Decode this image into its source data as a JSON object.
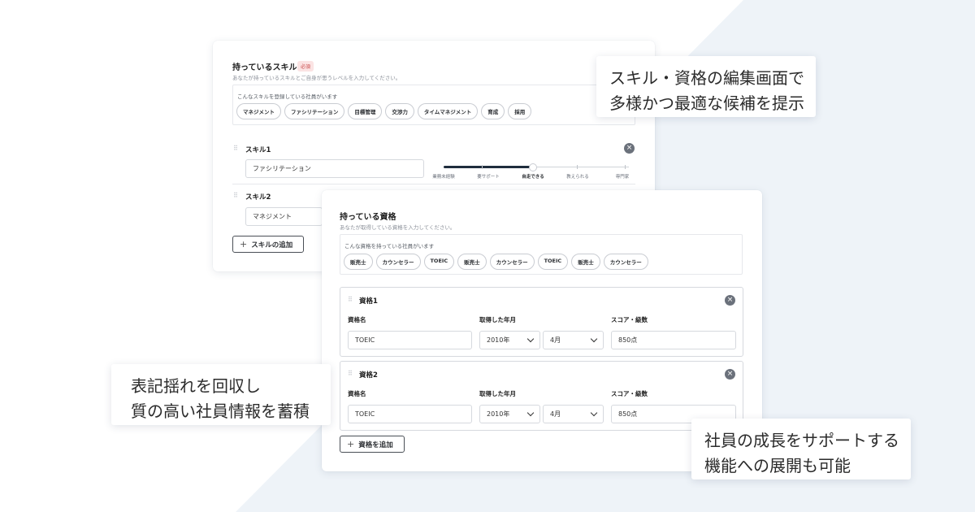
{
  "skills_section": {
    "title": "持っているスキル",
    "required_badge": "必須",
    "description": "あなたが持っているスキルとご自身が思うレベルを入力してください。",
    "suggestions_caption": "こんなスキルを登録している社員がいます",
    "suggestions": [
      "マネジメント",
      "ファシリテーション",
      "目標管理",
      "交渉力",
      "タイムマネジメント",
      "育成",
      "採用"
    ],
    "items": [
      {
        "label": "スキル1",
        "value": "ファシリテーション",
        "level": 0.5
      },
      {
        "label": "スキル2",
        "value": "マネジメント"
      }
    ],
    "level_labels": [
      "業務未経験",
      "要サポート",
      "自走できる",
      "教えられる",
      "専門家"
    ],
    "add_button": "スキルの追加"
  },
  "certs_section": {
    "title": "持っている資格",
    "description": "あなたが取得している資格を入力してください。",
    "suggestions_caption": "こんな資格を持っている社員がいます",
    "suggestions": [
      "販売士",
      "カウンセラー",
      "TOEIC",
      "販売士",
      "カウンセラー",
      "TOEIC",
      "販売士",
      "カウンセラー"
    ],
    "field_labels": {
      "name": "資格名",
      "date": "取得した年月",
      "score": "スコア・級数"
    },
    "items": [
      {
        "label": "資格1",
        "name": "TOEIC",
        "year": "2010年",
        "month": "4月",
        "score": "850点"
      },
      {
        "label": "資格2",
        "name": "TOEIC",
        "year": "2010年",
        "month": "4月",
        "score": "850点"
      }
    ],
    "add_button": "資格を追加"
  },
  "callouts": {
    "top_right": [
      "スキル・資格の編集画面で",
      "多様かつ最適な候補を提示"
    ],
    "bottom_left": [
      "表記揺れを回収し",
      "質の高い社員情報を蓄積"
    ],
    "bottom_right": [
      "社員の成長をサポートする",
      "機能への展開も可能"
    ]
  },
  "colors": {
    "background_shape": "#eef3f8",
    "accent_dark": "#1f2d3d",
    "required_red": "#c94a4a"
  }
}
